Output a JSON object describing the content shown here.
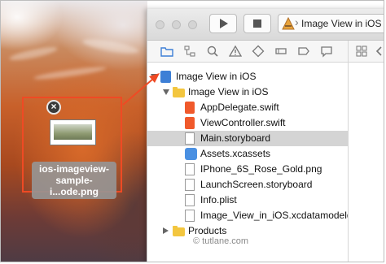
{
  "desktop": {
    "dragged_file": {
      "label": "ios-imageview-sample-i...ode.png",
      "close_symbol": "×",
      "highlight_color": "#ef4a24"
    }
  },
  "xcode": {
    "toolbar": {
      "scheme_label": "Image View in iOS",
      "scheme_chevron": "›"
    },
    "navigator_icons": [
      "folder-icon",
      "hierarchy-icon",
      "search-icon",
      "warning-icon",
      "test-diamond-icon",
      "debug-icon",
      "breakpoint-icon",
      "report-icon"
    ],
    "tree": [
      {
        "label": "Image View in iOS",
        "icon": "project-file-icon",
        "level": 0,
        "disclosure": "open"
      },
      {
        "label": "Image View in iOS",
        "icon": "folder-icon",
        "level": 1,
        "disclosure": "open"
      },
      {
        "label": "AppDelegate.swift",
        "icon": "swift-file-icon",
        "level": 2
      },
      {
        "label": "ViewController.swift",
        "icon": "swift-file-icon",
        "level": 2
      },
      {
        "label": "Main.storyboard",
        "icon": "storyboard-file-icon",
        "level": 2,
        "selected": true
      },
      {
        "label": "Assets.xcassets",
        "icon": "asset-catalog-icon",
        "level": 2
      },
      {
        "label": "IPhone_6S_Rose_Gold.png",
        "icon": "image-file-icon",
        "level": 2
      },
      {
        "label": "LaunchScreen.storyboard",
        "icon": "storyboard-file-icon",
        "level": 2
      },
      {
        "label": "Info.plist",
        "icon": "plist-file-icon",
        "level": 2
      },
      {
        "label": "Image_View_in_iOS.xcdatamodeld",
        "icon": "data-model-icon",
        "level": 2
      },
      {
        "label": "Products",
        "icon": "folder-icon",
        "level": 1,
        "disclosure": "closed"
      }
    ],
    "accent_color": "#3d7fd6",
    "selection_color": "#d4d4d4"
  },
  "watermark": "© tutlane.com"
}
